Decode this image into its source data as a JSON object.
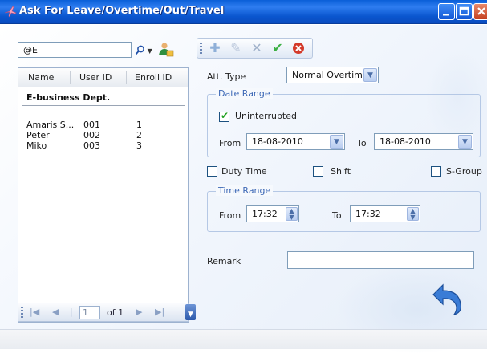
{
  "window": {
    "title": "Ask For Leave/Overtime/Out/Travel",
    "icon": "plane-icon",
    "controls": [
      "minimize-icon",
      "maximize-icon",
      "close-icon"
    ]
  },
  "search": {
    "value": "@E",
    "search_icon": "magnifier-icon",
    "dropdown_icon": "chevron-down-icon",
    "user_icon": "add-user-icon"
  },
  "list": {
    "columns": [
      "Name",
      "User ID",
      "Enroll ID"
    ],
    "group": "E-business Dept.",
    "rows": [
      {
        "name": "Amaris S...",
        "user_id": "001",
        "enroll_id": "1"
      },
      {
        "name": "Peter",
        "user_id": "002",
        "enroll_id": "2"
      },
      {
        "name": "Miko",
        "user_id": "003",
        "enroll_id": "3"
      }
    ]
  },
  "pager": {
    "page": "1",
    "of_label": "of 1"
  },
  "toolbar": {
    "buttons": [
      "add-icon",
      "edit-icon",
      "delete-icon",
      "check-icon",
      "cancel-icon"
    ]
  },
  "form": {
    "att_type_label": "Att. Type",
    "att_type_value": "Normal Overtime",
    "date_range": {
      "legend": "Date Range",
      "uninterrupted_label": "Uninterrupted",
      "uninterrupted_checked": true,
      "from_label": "From",
      "from_value": "18-08-2010",
      "to_label": "To",
      "to_value": "18-08-2010"
    },
    "duty_time_label": "Duty Time",
    "shift_label": "Shift",
    "sgroup_label": "S-Group",
    "time_range": {
      "legend": "Time Range",
      "from_label": "From",
      "from_value": "17:32",
      "to_label": "To",
      "to_value": "17:32"
    },
    "remark_label": "Remark",
    "remark_value": ""
  }
}
